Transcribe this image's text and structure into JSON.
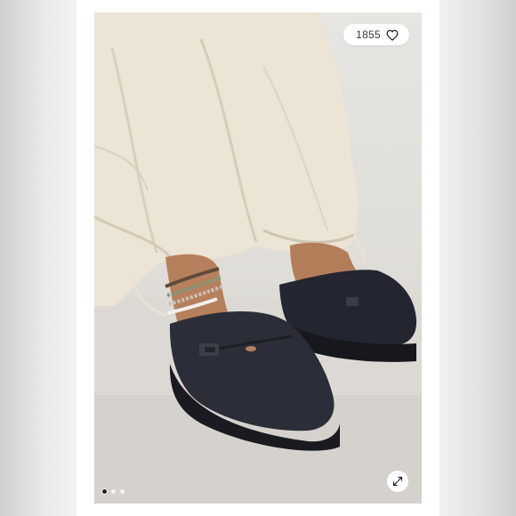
{
  "listing": {
    "like_count": "1855",
    "icons": {
      "like": "heart-outline-icon",
      "expand": "expand-arrows-icon"
    },
    "carousel": {
      "total_images": 3,
      "active_index": 0
    }
  }
}
